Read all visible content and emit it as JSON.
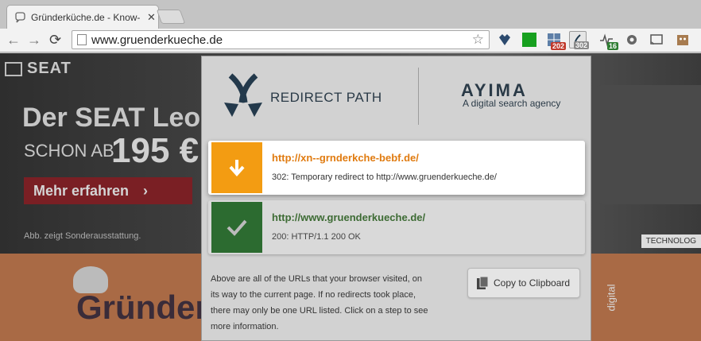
{
  "tab": {
    "title": "Gründerküche.de - Know-",
    "close": "✕"
  },
  "toolbar": {
    "url": "www.gruenderkueche.de",
    "extensions": [
      {
        "name": "heart-monitor",
        "badge": ""
      },
      {
        "name": "green-square",
        "badge": ""
      },
      {
        "name": "grid-badge",
        "badge": "202",
        "badge_color": "#c0392b"
      },
      {
        "name": "redirect-path",
        "badge": "302",
        "badge_color": "#8a8a8a"
      },
      {
        "name": "pulse",
        "badge": "16",
        "badge_color": "#2e7d32"
      }
    ]
  },
  "page": {
    "seat_brand": "SEAT",
    "headline": "Der SEAT Leon",
    "subline": "SCHON AB",
    "price": "195 €",
    "cta": "Mehr erfahren",
    "note": "Abb. zeigt Sonderausstattung.",
    "tech_label": "TECHNOLOG",
    "site_name": "Gründer",
    "digital": "digital"
  },
  "popup": {
    "title": "REDIRECT PATH",
    "brand": "AYIMA",
    "brand_tag": "A digital search agency",
    "steps": [
      {
        "url": "http://xn--grnderkche-bebf.de/",
        "status": "302: Temporary redirect to http://www.gruenderkueche.de/",
        "type": "redirect"
      },
      {
        "url": "http://www.gruenderkueche.de/",
        "status": "200: HTTP/1.1 200 OK",
        "type": "ok"
      }
    ],
    "info": "Above are all of the URLs that your browser visited, on its way to the current page. If no redirects took place, there may only be one URL listed. Click on a step to see more information.",
    "copy_label": "Copy to Clipboard"
  },
  "colors": {
    "redirect": "#f39c12",
    "ok": "#2c6b30",
    "redirect_text": "#e07b10",
    "ok_text": "#3d6b34"
  }
}
